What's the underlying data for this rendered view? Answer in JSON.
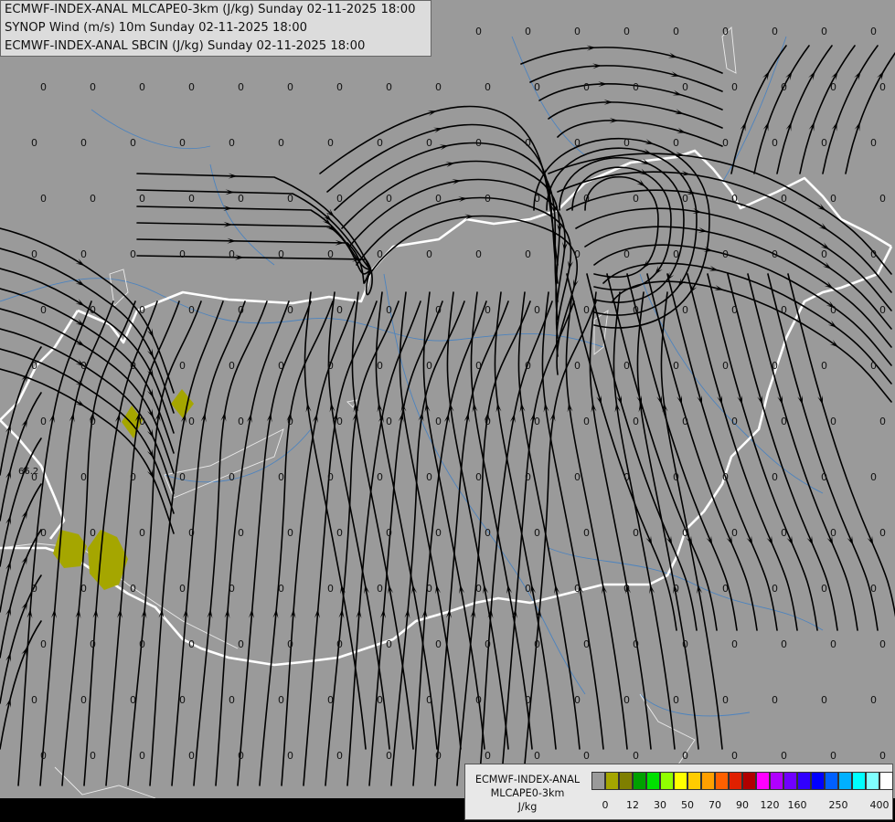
{
  "header": {
    "line1": "ECMWF-INDEX-ANAL MLCAPE0-3km (J/kg) Sunday 02-11-2025 18:00",
    "line2": "SYNOP Wind (m/s) 10m Sunday 02-11-2025 18:00",
    "line3": "ECMWF-INDEX-ANAL SBCIN (J/kg) Sunday 02-11-2025 18:00"
  },
  "map": {
    "background": "#9a9a9a",
    "grid_value": "0",
    "station_label": "66.2",
    "cape_blob_color": "#a5a600"
  },
  "legend": {
    "title1": "ECMWF-INDEX-ANAL",
    "title2": "MLCAPE0-3km",
    "unit": "J/kg",
    "colors": [
      "#9a9a9a",
      "#a5a600",
      "#7f7f00",
      "#00a000",
      "#00e000",
      "#90ff00",
      "#ffff00",
      "#ffcc00",
      "#ffa000",
      "#ff6000",
      "#e02000",
      "#b00000",
      "#ff00ff",
      "#b000ff",
      "#7000ff",
      "#3000ff",
      "#0000ff",
      "#0060ff",
      "#00b0ff",
      "#00ffff",
      "#80ffff",
      "#ffffff"
    ],
    "ticks": [
      "0",
      "12",
      "30",
      "50",
      "70",
      "90",
      "120",
      "160",
      "250",
      "400"
    ]
  }
}
